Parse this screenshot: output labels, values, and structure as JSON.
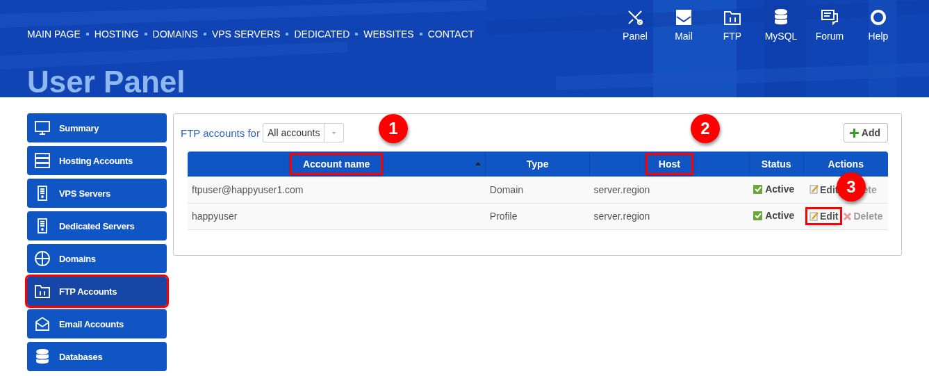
{
  "nav": [
    "MAIN PAGE",
    "HOSTING",
    "DOMAINS",
    "VPS SERVERS",
    "DEDICATED",
    "WEBSITES",
    "CONTACT"
  ],
  "tools": [
    {
      "kind": "tools",
      "label": "Panel"
    },
    {
      "kind": "mail",
      "label": "Mail"
    },
    {
      "kind": "ftp",
      "label": "FTP"
    },
    {
      "kind": "database",
      "label": "MySQL"
    },
    {
      "kind": "forum",
      "label": "Forum"
    },
    {
      "kind": "help",
      "label": "Help"
    }
  ],
  "page_title": "User Panel",
  "sidebar": {
    "items": [
      {
        "kind": "monitor",
        "label": "Summary",
        "selected": false,
        "highlighted": false
      },
      {
        "kind": "servers",
        "label": "Hosting Accounts",
        "selected": false,
        "highlighted": false
      },
      {
        "kind": "tower",
        "label": "VPS Servers",
        "selected": false,
        "highlighted": false
      },
      {
        "kind": "tower",
        "label": "Dedicated Servers",
        "selected": false,
        "highlighted": false
      },
      {
        "kind": "www",
        "label": "Domains",
        "selected": false,
        "highlighted": false
      },
      {
        "kind": "ftp",
        "label": "FTP Accounts",
        "selected": true,
        "highlighted": true
      },
      {
        "kind": "mail",
        "label": "Email Accounts",
        "selected": false,
        "highlighted": false
      },
      {
        "kind": "database",
        "label": "Databases",
        "selected": false,
        "highlighted": false
      }
    ]
  },
  "panel": {
    "filter_label": "FTP accounts for",
    "filter_value": "All accounts",
    "add_button": "Add",
    "table": {
      "columns": [
        {
          "label": "Account name",
          "highlighted": true,
          "badge": "1",
          "sorted": true
        },
        {
          "label": "Type",
          "highlighted": false,
          "sorted": false
        },
        {
          "label": "Host",
          "highlighted": true,
          "badge": "2",
          "sorted": false
        },
        {
          "label": "Status",
          "highlighted": false,
          "sorted": false
        },
        {
          "label": "Actions",
          "highlighted": false,
          "sorted": false
        }
      ],
      "rows": [
        {
          "account": "ftpuser@happyuser1.com",
          "type": "Domain",
          "host": "server.region",
          "status": "Active",
          "edit": {
            "label": "Edit",
            "highlighted": false,
            "badge": "3"
          },
          "delete": {
            "label": "ete",
            "icon": false
          }
        },
        {
          "account": "happyuser",
          "type": "Profile",
          "host": "server.region",
          "status": "Active",
          "edit": {
            "label": "Edit",
            "highlighted": true
          },
          "delete": {
            "label": "Delete",
            "icon": true
          }
        }
      ]
    }
  }
}
